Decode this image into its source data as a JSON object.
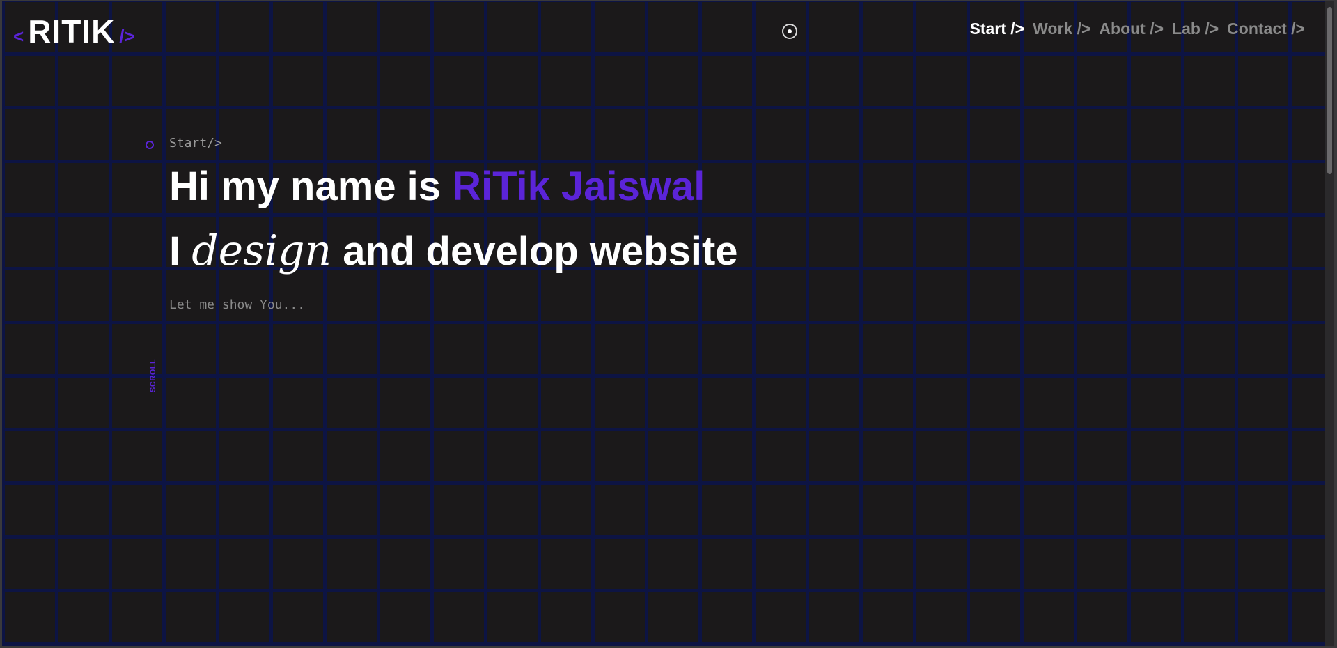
{
  "logo": {
    "open": "<",
    "name": "RITIK",
    "close": "/>"
  },
  "nav": {
    "items": [
      {
        "label": "Start />",
        "active": true
      },
      {
        "label": "Work />",
        "active": false
      },
      {
        "label": "About />",
        "active": false
      },
      {
        "label": "Lab />",
        "active": false
      },
      {
        "label": "Contact />",
        "active": false
      }
    ]
  },
  "hero": {
    "section_label": "Start/>",
    "line1_prefix": "Hi my name is ",
    "line1_name": "RiTik Jaiswal",
    "line2_prefix": "I ",
    "line2_italic": "design",
    "line2_suffix": " and develop website",
    "tagline": "Let me show You..."
  },
  "scroll_indicator": {
    "label": "SCROLL"
  },
  "colors": {
    "accent": "#5b24d8",
    "background": "#1b191a",
    "grid": "#0d1444",
    "text": "#ffffff",
    "muted": "#8a8a8a"
  }
}
